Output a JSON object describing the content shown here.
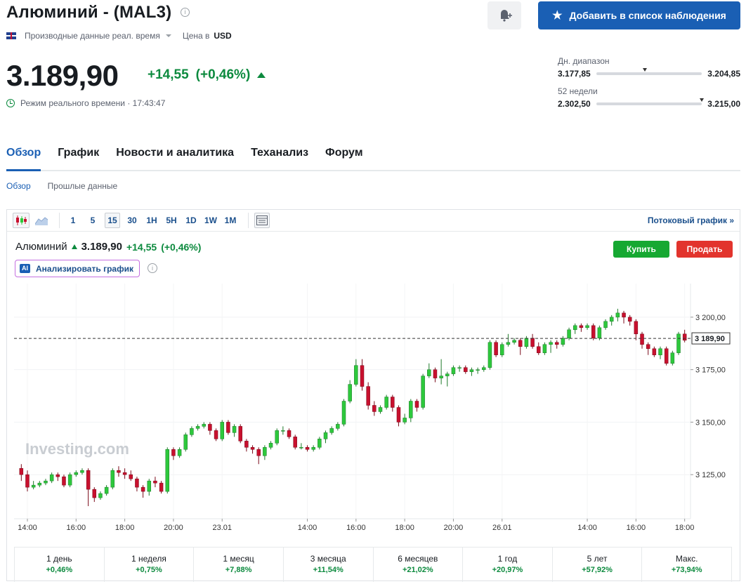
{
  "header": {
    "title": "Алюминий - (MAL3)",
    "info_icon": "i",
    "watch_button": "Добавить в список наблюдения",
    "data_type": "Производные данные реал. время",
    "currency_label": "Цена в",
    "currency": "USD"
  },
  "quote": {
    "price": "3.189,90",
    "change": "+14,55",
    "change_pct": "(+0,46%)",
    "realtime": "Режим реального времени · 17:43:47"
  },
  "ranges": {
    "day": {
      "label": "Дн. диапазон",
      "low": "3.177,85",
      "high": "3.204,85"
    },
    "week52": {
      "label": "52 недели",
      "low": "2.302,50",
      "high": "3.215,00"
    }
  },
  "tabs": [
    "Обзор",
    "График",
    "Новости и аналитика",
    "Теханализ",
    "Форум"
  ],
  "subtabs": [
    "Обзор",
    "Прошлые данные"
  ],
  "toolbar": {
    "intervals": [
      "1",
      "5",
      "15",
      "30",
      "1H",
      "5H",
      "1D",
      "1W",
      "1M"
    ],
    "active_interval": "15",
    "stream_link": "Потоковый график »"
  },
  "chart_header": {
    "name": "Алюминий",
    "value": "3.189,90",
    "change": "+14,55",
    "change_pct": "(+0,46%)",
    "buy": "Купить",
    "sell": "Продать",
    "ai_badge": "AI",
    "ai_button": "Анализировать график"
  },
  "chart_data": {
    "type": "candlestick",
    "title": "",
    "watermark": "Investing.com",
    "y_ticks": [
      "3 200,00",
      "3 175,00",
      "3 150,00",
      "3 125,00"
    ],
    "y_tick_values": [
      3200,
      3175,
      3150,
      3125
    ],
    "last_price_label": "3 189,90",
    "last_price": 3189.9,
    "ylim": [
      3104,
      3216
    ],
    "x_ticks": [
      "14:00",
      "16:00",
      "18:00",
      "20:00",
      "23.01",
      "14:00",
      "16:00",
      "18:00",
      "20:00",
      "26.01",
      "14:00",
      "16:00",
      "18:00"
    ],
    "x_tick_index": [
      1,
      9,
      17,
      25,
      33,
      47,
      55,
      63,
      71,
      79,
      93,
      101,
      109
    ],
    "colors": {
      "up": "#2dc83c",
      "down": "#c8102e"
    },
    "candles": [
      [
        3128,
        3125,
        3130,
        3122
      ],
      [
        3125,
        3119,
        3127,
        3117
      ],
      [
        3119,
        3120,
        3122,
        3118
      ],
      [
        3120,
        3121,
        3122,
        3119
      ],
      [
        3121,
        3122,
        3123,
        3120
      ],
      [
        3122,
        3125,
        3126,
        3121
      ],
      [
        3125,
        3124,
        3126,
        3122
      ],
      [
        3124,
        3120,
        3125,
        3119
      ],
      [
        3120,
        3125,
        3126,
        3119
      ],
      [
        3125,
        3126,
        3127,
        3124
      ],
      [
        3126,
        3127,
        3128,
        3125
      ],
      [
        3127,
        3118,
        3128,
        3110
      ],
      [
        3118,
        3114,
        3119,
        3112
      ],
      [
        3114,
        3116,
        3117,
        3113
      ],
      [
        3116,
        3119,
        3120,
        3115
      ],
      [
        3119,
        3127,
        3128,
        3118
      ],
      [
        3127,
        3126,
        3129,
        3124
      ],
      [
        3126,
        3125,
        3128,
        3123
      ],
      [
        3125,
        3123,
        3127,
        3122
      ],
      [
        3123,
        3119,
        3124,
        3117
      ],
      [
        3119,
        3117,
        3120,
        3114
      ],
      [
        3117,
        3122,
        3123,
        3115
      ],
      [
        3122,
        3121,
        3124,
        3119
      ],
      [
        3121,
        3117,
        3122,
        3116
      ],
      [
        3117,
        3137,
        3138,
        3116
      ],
      [
        3137,
        3134,
        3138,
        3132
      ],
      [
        3134,
        3137,
        3138,
        3133
      ],
      [
        3137,
        3144,
        3145,
        3136
      ],
      [
        3144,
        3147,
        3148,
        3143
      ],
      [
        3147,
        3148,
        3149,
        3146
      ],
      [
        3148,
        3149,
        3150,
        3147
      ],
      [
        3149,
        3146,
        3150,
        3144
      ],
      [
        3146,
        3142,
        3147,
        3141
      ],
      [
        3142,
        3150,
        3151,
        3141
      ],
      [
        3150,
        3145,
        3151,
        3144
      ],
      [
        3145,
        3148,
        3149,
        3143
      ],
      [
        3148,
        3141,
        3149,
        3140
      ],
      [
        3141,
        3138,
        3142,
        3136
      ],
      [
        3138,
        3137,
        3139,
        3135
      ],
      [
        3137,
        3134,
        3138,
        3130
      ],
      [
        3134,
        3138,
        3139,
        3132
      ],
      [
        3138,
        3140,
        3141,
        3137
      ],
      [
        3140,
        3146,
        3147,
        3139
      ],
      [
        3146,
        3146,
        3148,
        3144
      ],
      [
        3146,
        3143,
        3147,
        3142
      ],
      [
        3143,
        3138,
        3144,
        3137
      ],
      [
        3138,
        3138,
        3140,
        3137
      ],
      [
        3138,
        3137,
        3139,
        3136
      ],
      [
        3137,
        3138,
        3139,
        3136
      ],
      [
        3138,
        3142,
        3143,
        3137
      ],
      [
        3142,
        3145,
        3146,
        3140
      ],
      [
        3145,
        3147,
        3148,
        3144
      ],
      [
        3147,
        3149,
        3150,
        3146
      ],
      [
        3149,
        3160,
        3161,
        3148
      ],
      [
        3160,
        3168,
        3170,
        3159
      ],
      [
        3168,
        3177,
        3180,
        3167
      ],
      [
        3177,
        3167,
        3180,
        3165
      ],
      [
        3167,
        3158,
        3169,
        3156
      ],
      [
        3158,
        3155,
        3160,
        3153
      ],
      [
        3155,
        3157,
        3158,
        3154
      ],
      [
        3157,
        3162,
        3163,
        3156
      ],
      [
        3162,
        3157,
        3163,
        3155
      ],
      [
        3157,
        3150,
        3158,
        3148
      ],
      [
        3150,
        3152,
        3154,
        3149
      ],
      [
        3152,
        3160,
        3161,
        3150
      ],
      [
        3160,
        3157,
        3161,
        3155
      ],
      [
        3157,
        3172,
        3173,
        3156
      ],
      [
        3172,
        3175,
        3178,
        3171
      ],
      [
        3175,
        3171,
        3176,
        3169
      ],
      [
        3171,
        3172,
        3180,
        3168
      ],
      [
        3172,
        3173,
        3174,
        3167
      ],
      [
        3173,
        3176,
        3177,
        3172
      ],
      [
        3176,
        3176,
        3177,
        3174
      ],
      [
        3176,
        3174,
        3177,
        3173
      ],
      [
        3174,
        3175,
        3176,
        3172
      ],
      [
        3175,
        3175,
        3176,
        3173
      ],
      [
        3175,
        3176,
        3177,
        3174
      ],
      [
        3176,
        3188,
        3189,
        3175
      ],
      [
        3188,
        3182,
        3189,
        3181
      ],
      [
        3182,
        3187,
        3188,
        3181
      ],
      [
        3187,
        3188,
        3192,
        3186
      ],
      [
        3188,
        3189,
        3190,
        3187
      ],
      [
        3189,
        3186,
        3190,
        3182
      ],
      [
        3186,
        3190,
        3191,
        3185
      ],
      [
        3190,
        3186,
        3192,
        3185
      ],
      [
        3186,
        3183,
        3188,
        3182
      ],
      [
        3183,
        3187,
        3188,
        3182
      ],
      [
        3187,
        3188,
        3189,
        3183
      ],
      [
        3188,
        3187,
        3189,
        3185
      ],
      [
        3187,
        3190,
        3191,
        3186
      ],
      [
        3190,
        3194,
        3195,
        3189
      ],
      [
        3194,
        3196,
        3197,
        3192
      ],
      [
        3196,
        3195,
        3197,
        3193
      ],
      [
        3195,
        3196,
        3197,
        3194
      ],
      [
        3196,
        3190,
        3197,
        3189
      ],
      [
        3190,
        3195,
        3196,
        3189
      ],
      [
        3195,
        3198,
        3199,
        3194
      ],
      [
        3198,
        3200,
        3201,
        3196
      ],
      [
        3200,
        3202,
        3204,
        3198
      ],
      [
        3202,
        3200,
        3203,
        3197
      ],
      [
        3200,
        3198,
        3201,
        3196
      ],
      [
        3198,
        3192,
        3199,
        3189
      ],
      [
        3192,
        3187,
        3193,
        3185
      ],
      [
        3187,
        3185,
        3188,
        3182
      ],
      [
        3185,
        3182,
        3186,
        3181
      ],
      [
        3182,
        3185,
        3186,
        3180
      ],
      [
        3185,
        3178,
        3186,
        3177
      ],
      [
        3178,
        3183,
        3184,
        3177
      ],
      [
        3183,
        3192,
        3193,
        3182
      ],
      [
        3192,
        3189,
        3194,
        3188
      ]
    ]
  },
  "performance": [
    {
      "label": "1 день",
      "value": "+0,46%"
    },
    {
      "label": "1 неделя",
      "value": "+0,75%"
    },
    {
      "label": "1 месяц",
      "value": "+7,88%"
    },
    {
      "label": "3 месяца",
      "value": "+11,54%"
    },
    {
      "label": "6 месяцев",
      "value": "+21,02%"
    },
    {
      "label": "1 год",
      "value": "+20,97%"
    },
    {
      "label": "5 лет",
      "value": "+57,92%"
    },
    {
      "label": "Макс.",
      "value": "+73,94%"
    }
  ]
}
